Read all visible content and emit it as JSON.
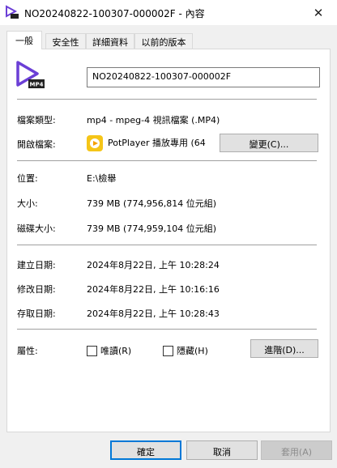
{
  "window": {
    "title": "NO20240822-100307-000002F - 內容",
    "close_glyph": "✕"
  },
  "tabs": [
    {
      "label": "一般",
      "active": true
    },
    {
      "label": "安全性",
      "active": false
    },
    {
      "label": "詳細資料",
      "active": false
    },
    {
      "label": "以前的版本",
      "active": false
    }
  ],
  "general": {
    "file_icon_badge": "MP4",
    "file_name": "NO20240822-100307-000002F",
    "file_type_label": "檔案類型:",
    "file_type_value": "mp4 - mpeg-4 視訊檔案 (.MP4)",
    "opens_with_label": "開啟檔案:",
    "opens_with_value": "PotPlayer 播放專用 (64",
    "change_button": "變更(C)...",
    "location_label": "位置:",
    "location_value": "E:\\檢舉",
    "size_label": "大小:",
    "size_value": "739 MB (774,956,814 位元組)",
    "size_on_disk_label": "磁碟大小:",
    "size_on_disk_value": "739 MB (774,959,104 位元組)",
    "created_label": "建立日期:",
    "created_value": "2024年8月22日, 上午 10:28:24",
    "modified_label": "修改日期:",
    "modified_value": "2024年8月22日, 上午 10:16:16",
    "accessed_label": "存取日期:",
    "accessed_value": "2024年8月22日, 上午 10:28:43",
    "attributes_label": "屬性:",
    "readonly_label": "唯讀(R)",
    "hidden_label": "隱藏(H)",
    "advanced_button": "進階(D)..."
  },
  "footer": {
    "ok": "確定",
    "cancel": "取消",
    "apply": "套用(A)"
  },
  "colors": {
    "icon_purple": "#6b3fd6",
    "potplayer_yellow": "#f5c518"
  }
}
